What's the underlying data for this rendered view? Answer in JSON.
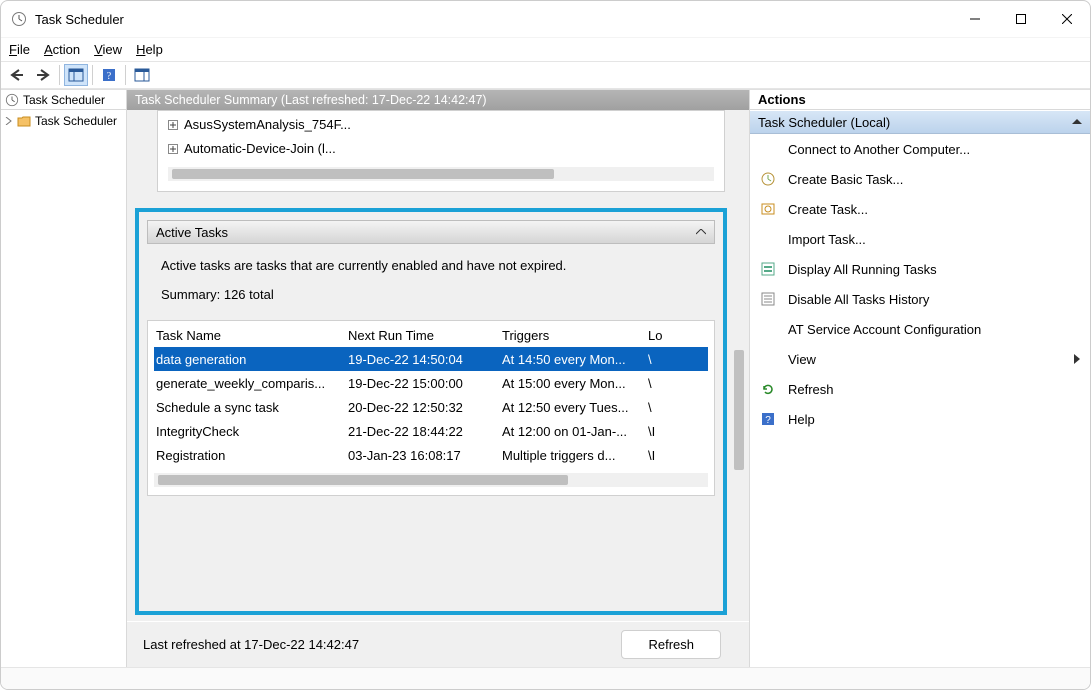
{
  "window": {
    "title": "Task Scheduler"
  },
  "menu": {
    "file": "File",
    "action": "Action",
    "view": "View",
    "help": "Help"
  },
  "nav": {
    "header": "Task Scheduler",
    "root": "Task Scheduler"
  },
  "center": {
    "header": "Task Scheduler Summary (Last refreshed: 17-Dec-22 14:42:47)",
    "upper_items": [
      "AsusSystemAnalysis_754F...",
      "Automatic-Device-Join (l..."
    ],
    "active_tasks": {
      "title": "Active Tasks",
      "description": "Active tasks are tasks that are currently enabled and have not expired.",
      "summary": "Summary: 126 total",
      "columns": [
        "Task Name",
        "Next Run Time",
        "Triggers",
        "Lo"
      ],
      "rows": [
        {
          "name": "data generation",
          "next": "19-Dec-22 14:50:04",
          "trig": "At 14:50 every Mon...",
          "loc": "\\",
          "selected": true
        },
        {
          "name": "generate_weekly_comparis...",
          "next": "19-Dec-22 15:00:00",
          "trig": "At 15:00 every Mon...",
          "loc": "\\"
        },
        {
          "name": "Schedule a sync task",
          "next": "20-Dec-22 12:50:32",
          "trig": "At 12:50 every Tues...",
          "loc": "\\"
        },
        {
          "name": "IntegrityCheck",
          "next": "21-Dec-22 18:44:22",
          "trig": "At 12:00 on 01-Jan-...",
          "loc": "\\I"
        },
        {
          "name": "Registration",
          "next": "03-Jan-23 16:08:17",
          "trig": "Multiple triggers d...",
          "loc": "\\I"
        }
      ]
    },
    "footer_text": "Last refreshed at 17-Dec-22 14:42:47",
    "refresh_btn": "Refresh"
  },
  "actions": {
    "header": "Actions",
    "group": "Task Scheduler (Local)",
    "items": [
      {
        "label": "Connect to Another Computer...",
        "icon": "blank"
      },
      {
        "label": "Create Basic Task...",
        "icon": "basic-task"
      },
      {
        "label": "Create Task...",
        "icon": "task"
      },
      {
        "label": "Import Task...",
        "icon": "blank"
      },
      {
        "label": "Display All Running Tasks",
        "icon": "running"
      },
      {
        "label": "Disable All Tasks History",
        "icon": "history"
      },
      {
        "label": "AT Service Account Configuration",
        "icon": "blank"
      },
      {
        "label": "View",
        "icon": "blank",
        "submenu": true
      },
      {
        "label": "Refresh",
        "icon": "refresh"
      },
      {
        "label": "Help",
        "icon": "help"
      }
    ]
  }
}
